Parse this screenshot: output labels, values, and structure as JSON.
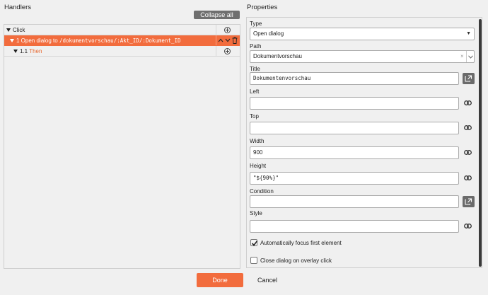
{
  "handlers": {
    "title": "Handlers",
    "collapse_all_label": "Collapse all",
    "rows": [
      {
        "label": "Click"
      },
      {
        "prefix": "1 Open dialog to ",
        "path": "/dokumentvorschau/:Akt_ID/:Dokument_ID"
      },
      {
        "number": "1.1",
        "then": "Then"
      }
    ]
  },
  "properties": {
    "title": "Properties",
    "type": {
      "label": "Type",
      "value": "Open dialog"
    },
    "path": {
      "label": "Path",
      "value": "Dokumentvorschau",
      "clear": "×"
    },
    "title_field": {
      "label": "Title",
      "value": "Dokumentenvorschau"
    },
    "left": {
      "label": "Left",
      "value": ""
    },
    "top": {
      "label": "Top",
      "value": ""
    },
    "width": {
      "label": "Width",
      "value": "900"
    },
    "height": {
      "label": "Height",
      "value": "\"${90%}\""
    },
    "condition": {
      "label": "Condition",
      "value": ""
    },
    "style": {
      "label": "Style",
      "value": ""
    },
    "autofocus": {
      "label": "Automatically focus first element",
      "checked": true
    },
    "close_overlay": {
      "label": "Close dialog on overlay click",
      "checked": false
    }
  },
  "footer": {
    "done_label": "Done",
    "cancel_label": "Cancel"
  },
  "colors": {
    "accent": "#f26c3d",
    "button_gray": "#6f6f6f"
  }
}
